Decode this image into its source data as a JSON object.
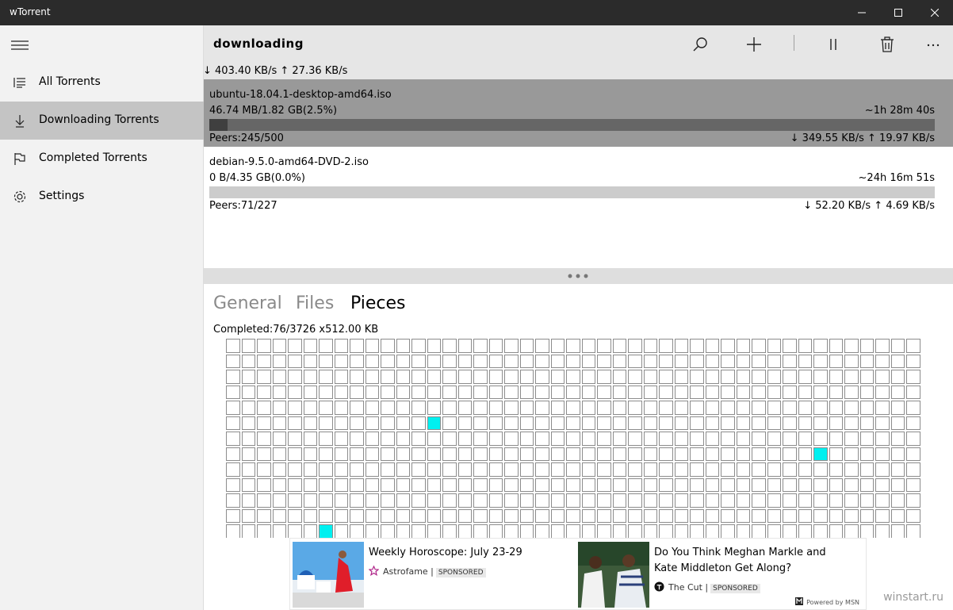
{
  "window": {
    "title": "wTorrent"
  },
  "sidebar": {
    "items": [
      {
        "label": "All Torrents",
        "icon": "list-icon"
      },
      {
        "label": "Downloading Torrents",
        "icon": "download-arrow-icon"
      },
      {
        "label": "Completed Torrents",
        "icon": "flag-icon"
      },
      {
        "label": "Settings",
        "icon": "gear-icon"
      }
    ],
    "active_index": 1
  },
  "header": {
    "title": "downloading",
    "total_speed": "↓ 403.40 KB/s ↑ 27.36 KB/s"
  },
  "torrents": [
    {
      "name": "ubuntu-18.04.1-desktop-amd64.iso",
      "size": "46.74 MB/1.82 GB(2.5%)",
      "eta": "~1h 28m 40s",
      "progress": 0.025,
      "peers": "Peers:245/500",
      "speed": "↓ 349.55 KB/s ↑ 19.97 KB/s",
      "selected": true
    },
    {
      "name": "debian-9.5.0-amd64-DVD-2.iso",
      "size": "0 B/4.35 GB(0.0%)",
      "eta": "~24h 16m 51s",
      "progress": 0.0,
      "peers": "Peers:71/227",
      "speed": "↓ 52.20 KB/s ↑ 4.69 KB/s",
      "selected": false
    }
  ],
  "detail": {
    "tabs": [
      {
        "label": "General"
      },
      {
        "label": "Files"
      },
      {
        "label": "Pieces"
      }
    ],
    "active_tab": 2,
    "completed_text": "Completed:76/3726 x512.00 KB",
    "pieces": {
      "columns": 45,
      "visible_rows": 13,
      "done_cells": [
        [
          5,
          13
        ],
        [
          7,
          38
        ],
        [
          12,
          6
        ]
      ]
    }
  },
  "ads": [
    {
      "headline": "Weekly Horoscope: July 23-29",
      "source": "Astrofame |",
      "sponsored": "SPONSORED"
    },
    {
      "headline": "Do You Think Meghan Markle and Kate Middleton Get Along?",
      "source": "The Cut |",
      "sponsored": "SPONSORED"
    }
  ],
  "powered_by": "Powered by MSN",
  "watermark": "winstart.ru",
  "colors": {
    "titlebar": "#2b2b2b",
    "selected_row": "#999999",
    "selected_bar_track": "#666666",
    "selected_bar_fill": "#3f3f3f",
    "bar_track": "#cccccc",
    "piece_done": "#00f0f0",
    "active_nav": "#c4c4c4"
  }
}
